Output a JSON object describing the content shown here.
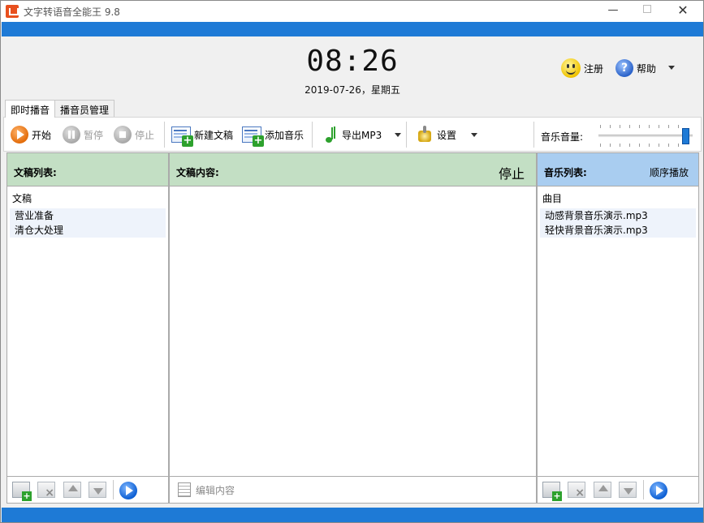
{
  "window": {
    "title": "文字转语音全能王 9.8"
  },
  "header": {
    "time": "08:26",
    "date": "2019-07-26，星期五",
    "register_label": "注册",
    "help_label": "帮助"
  },
  "tabs": [
    {
      "label": "即时播音"
    },
    {
      "label": "播音员管理"
    }
  ],
  "toolbar": {
    "start_label": "开始",
    "pause_label": "暂停",
    "stop_label": "停止",
    "new_doc_label": "新建文稿",
    "add_music_label": "添加音乐",
    "export_label": "导出MP3",
    "settings_label": "设置",
    "volume_label": "音乐音量:",
    "volume_level": 0.95
  },
  "doc_panel": {
    "title": "文稿列表:",
    "column": "文稿",
    "items": [
      "营业准备",
      "清仓大处理"
    ]
  },
  "content_panel": {
    "title": "文稿内容:",
    "status": "停止",
    "edit_label": "编辑内容"
  },
  "music_panel": {
    "title": "音乐列表:",
    "mode": "顺序播放",
    "column": "曲目",
    "items": [
      "动感背景音乐演示.mp3",
      "轻快背景音乐演示.mp3"
    ]
  },
  "colors": {
    "accent_blue": "#1e7ad6",
    "header_green": "#c3dfc4",
    "header_blue": "#a9cdf0"
  }
}
